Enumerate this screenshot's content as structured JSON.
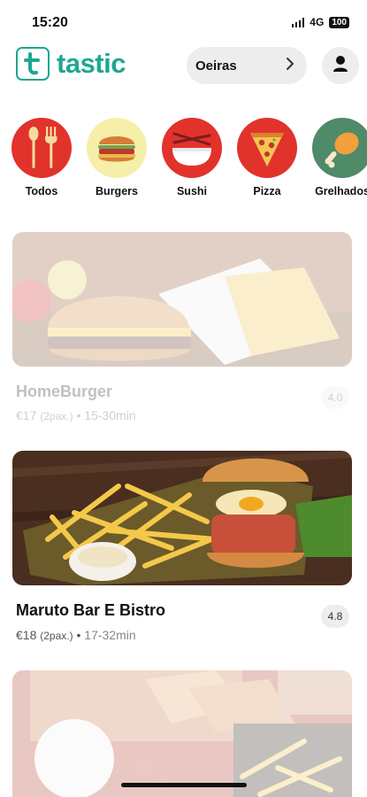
{
  "status_bar": {
    "time": "15:20",
    "network": "4G",
    "battery": "100"
  },
  "header": {
    "logo_text": "tastic",
    "logo_letter": "t",
    "location": "Oeiras"
  },
  "categories": [
    {
      "label": "Todos",
      "icon": "cutlery-icon",
      "bg": "#e2322c"
    },
    {
      "label": "Burgers",
      "icon": "burger-icon",
      "bg": "#f5efaa"
    },
    {
      "label": "Sushi",
      "icon": "bowl-chopsticks-icon",
      "bg": "#e2322c"
    },
    {
      "label": "Pizza",
      "icon": "pizza-slice-icon",
      "bg": "#e2322c"
    },
    {
      "label": "Grelhados",
      "icon": "chicken-leg-icon",
      "bg": "#4f8a69"
    }
  ],
  "restaurants": [
    {
      "name": "HomeBurger",
      "price": "€17",
      "pax": "(2pax.)",
      "time": "15-30min",
      "rating": "4.0",
      "unavailable": true
    },
    {
      "name": "Maruto Bar E Bistro",
      "price": "€18",
      "pax": "(2pax.)",
      "time": "17-32min",
      "rating": "4.8",
      "unavailable": false
    },
    {
      "name": "",
      "unavailable": true
    }
  ],
  "separator": "•",
  "colors": {
    "brand": "#1fa692",
    "category_red": "#e2322c",
    "pill_bg": "#ededed"
  }
}
